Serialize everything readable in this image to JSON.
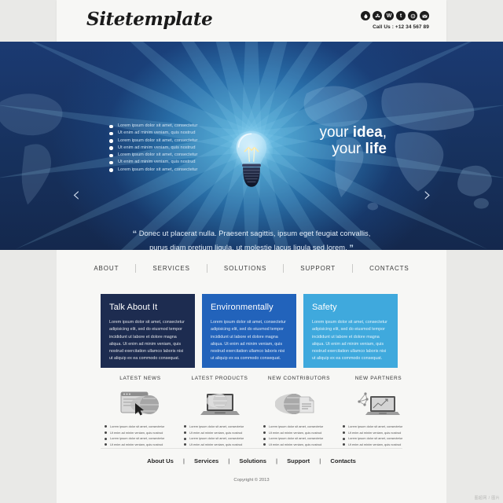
{
  "header": {
    "logo": "Sitetemplate",
    "call_label": "Call Us : +12 34 567 89",
    "social": [
      {
        "name": "dribbble-icon",
        "glyph": "●"
      },
      {
        "name": "flickr-icon",
        "glyph": "✿"
      },
      {
        "name": "wordpress-icon",
        "glyph": "W"
      },
      {
        "name": "tumblr-icon",
        "glyph": "t"
      },
      {
        "name": "rss-icon",
        "glyph": "◎"
      },
      {
        "name": "email-icon",
        "glyph": "✉"
      }
    ]
  },
  "hero": {
    "bullets": [
      "Lorem ipsum dolor sit amet, consectetur",
      "Ut enim ad minim veniam, quis nostrud",
      "Lorem ipsum dolor sit amet, consectetur",
      "Ut enim ad minim veniam, quis nostrud",
      "Lorem ipsum dolor sit amet, consectetur",
      "Ut enim ad minim veniam, quis nostrud",
      "Lorem ipsum dolor sit amet, consectetur"
    ],
    "headline_line1_plain": "your ",
    "headline_line1_bold": "idea",
    "headline_line1_tail": ",",
    "headline_line2_plain": "your ",
    "headline_line2_bold": "life",
    "quote_line1": "Donec ut placerat nulla. Praesent sagittis, ipsum eget feugiat convallis,",
    "quote_line2": "purus diam pretium ligula, ut molestie lacus ligula sed lorem.",
    "quote_mark_open": "“",
    "quote_mark_close": "”",
    "arrow_prev": "‹",
    "arrow_next": "›",
    "dots_count": 3,
    "active_dot": 0,
    "colors": {
      "deep": "#14284d",
      "mid": "#1b3a72",
      "glow": "#4fb9e3"
    }
  },
  "nav": {
    "items": [
      "ABOUT",
      "SERVICES",
      "SOLUTIONS",
      "SUPPORT",
      "CONTACTS"
    ]
  },
  "cards": [
    {
      "title": "Talk About It",
      "body": "Lorem ipsum dolor sit amet, consectetur adipisicing elit, sed do eiusmod tempor incididunt ut labore et dolore magna aliqua. Ut enim ad minim veniam, quis nostrud exercitation ullamco laboris nisi ut aliquip ex ea commodo consequat.",
      "color": "#1d2c50"
    },
    {
      "title": "Environmentally",
      "body": "Lorem ipsum dolor sit amet, consectetur adipisicing elit, sed do eiusmod tempor incididunt ut labore et dolore magna aliqua. Ut enim ad minim veniam, quis nostrud exercitation ullamco laboris nisi ut aliquip ex ea commodo consequat.",
      "color": "#2263bb"
    },
    {
      "title": "Safety",
      "body": "Lorem ipsum dolor sit amet, consectetur adipisicing elit, sed do eiusmod tempor incididunt ut labore et dolore magna aliqua. Ut enim ad minim veniam, quis nostrud exercitation ullamco laboris nisi ut aliquip ex ea commodo consequat.",
      "color": "#3fa9dd"
    }
  ],
  "lower_sections": [
    {
      "heading": "LATEST NEWS",
      "icon": "browser-globe-cursor-icon",
      "items": [
        "Lorem ipsum dolor sit amet, consectetur",
        "Ut enim ad minim veniam, quis nostrud",
        "Lorem ipsum dolor sit amet, consectetur",
        "Ut enim ad minim veniam, quis nostrud"
      ]
    },
    {
      "heading": "LATEST PRODUCTS",
      "icon": "laptop-globe-icon",
      "items": [
        "Lorem ipsum dolor sit amet, consectetur",
        "Ut enim ad minim veniam, quis nostrud",
        "Lorem ipsum dolor sit amet, consectetur",
        "Ut enim ad minim veniam, quis nostrud"
      ]
    },
    {
      "heading": "NEW CONTRIBUTORS",
      "icon": "globe-document-icon",
      "items": [
        "Lorem ipsum dolor sit amet, consectetur",
        "Ut enim ad minim veniam, quis nostrud",
        "Lorem ipsum dolor sit amet, consectetur",
        "Ut enim ad minim veniam, quis nostrud"
      ]
    },
    {
      "heading": "NEW PARTNERS",
      "icon": "laptop-chart-icon",
      "items": [
        "Lorem ipsum dolor sit amet, consectetur",
        "Ut enim ad minim veniam, quis nostrud",
        "Lorem ipsum dolor sit amet, consectetur",
        "Ut enim ad minim veniam, quis nostrud"
      ]
    }
  ],
  "footer": {
    "links": [
      "About Us",
      "Services",
      "Solutions",
      "Support",
      "Contacts"
    ],
    "separator": "|",
    "copyright": "Copyright © 2013"
  },
  "watermark": "图超网 / 图片"
}
